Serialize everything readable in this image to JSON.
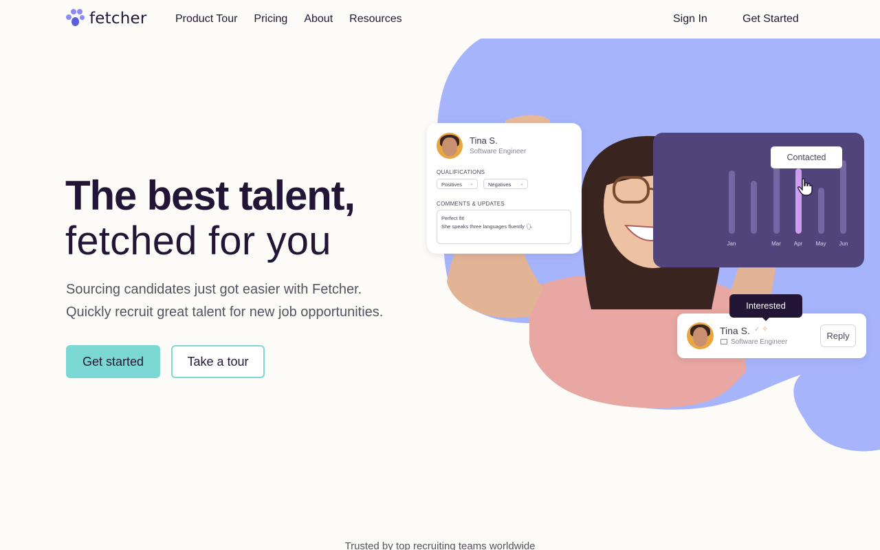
{
  "brand": {
    "name": "fetcher",
    "accent": "#8a8cf5",
    "dark": "#231536",
    "teal": "#7bd7d3",
    "lavender": "#a6b4fb"
  },
  "nav": {
    "links": [
      "Product Tour",
      "Pricing",
      "About",
      "Resources"
    ],
    "sign_in": "Sign In",
    "get_started": "Get Started"
  },
  "hero": {
    "headline_line1": "The best talent,",
    "headline_line2": "fetched for you",
    "subtitle_line1": "Sourcing candidates just got easier with Fetcher.",
    "subtitle_line2": "Quickly recruit great talent for new job opportunities.",
    "cta_primary": "Get started",
    "cta_secondary": "Take a tour"
  },
  "profile_card": {
    "name": "Tina S.",
    "role": "Software Engineer",
    "qualifications_label": "QUALIFICATIONS",
    "chip_positives": "Positives",
    "chip_negatives": "Negatives",
    "comments_label": "COMMENTS & UPDATES",
    "comment_line1": "Perfect fit!",
    "comment_line2": "She speaks three languages fluently 🗣"
  },
  "chart_card": {
    "tooltip": "Contacted",
    "months": [
      "Jan",
      "Mar",
      "Apr",
      "May",
      "Jun"
    ]
  },
  "contact_card": {
    "status": "Interested",
    "name": "Tina S.",
    "check": "✓",
    "star": "✧",
    "role": "Software Engineer",
    "reply": "Reply"
  },
  "footer": {
    "trusted": "Trusted by top recruiting teams worldwide"
  }
}
